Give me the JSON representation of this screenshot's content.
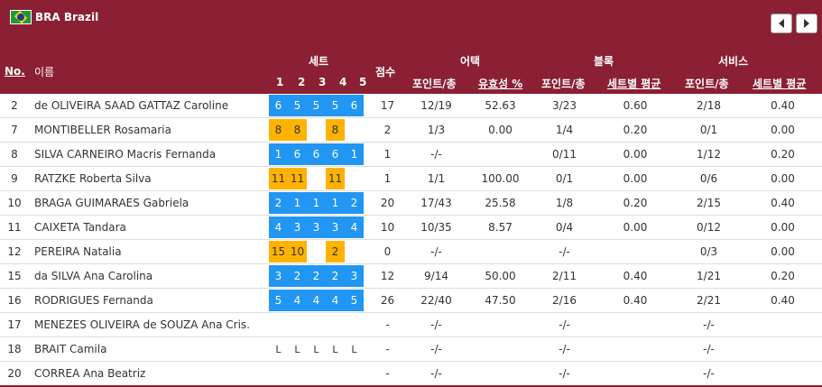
{
  "team": {
    "name": "BRA Brazil"
  },
  "headers": {
    "no": "No.",
    "name": "이름",
    "sets": "세트",
    "set_numbers": [
      "1",
      "2",
      "3",
      "4",
      "5"
    ],
    "points": "점수",
    "attack": "어택",
    "attack_pt": "포인트/총",
    "attack_eff": "유효성 %",
    "block": "블록",
    "block_pt": "포인트/총",
    "block_avg": "세트별 평균",
    "serve": "서비스",
    "serve_pt": "포인트/총",
    "serve_avg": "세트별 평균"
  },
  "colors": {
    "header_bg": "#8b1f33",
    "set_blue": "#2196f3",
    "set_yellow": "#ffb300"
  },
  "players": [
    {
      "no": "2",
      "name": "de OLIVEIRA SAAD GATTAZ Caroline",
      "sets": [
        [
          "6",
          "b"
        ],
        [
          "5",
          "b"
        ],
        [
          "5",
          "b"
        ],
        [
          "5",
          "b"
        ],
        [
          "6",
          "b"
        ]
      ],
      "points": "17",
      "att": "12/19",
      "eff": "52.63",
      "blk": "3/23",
      "blk_avg": "0.60",
      "srv": "2/18",
      "srv_avg": "0.40"
    },
    {
      "no": "7",
      "name": "MONTIBELLER Rosamaria",
      "sets": [
        [
          "8",
          "y"
        ],
        [
          "8",
          "y"
        ],
        [
          "",
          ""
        ],
        [
          "8",
          "y"
        ],
        [
          "",
          ""
        ]
      ],
      "points": "2",
      "att": "1/3",
      "eff": "0.00",
      "blk": "1/4",
      "blk_avg": "0.20",
      "srv": "0/1",
      "srv_avg": "0.00"
    },
    {
      "no": "8",
      "name": "SILVA CARNEIRO Macris Fernanda",
      "sets": [
        [
          "1",
          "b"
        ],
        [
          "6",
          "b"
        ],
        [
          "6",
          "b"
        ],
        [
          "6",
          "b"
        ],
        [
          "1",
          "b"
        ]
      ],
      "points": "1",
      "att": "-/-",
      "eff": "",
      "blk": "0/11",
      "blk_avg": "0.00",
      "srv": "1/12",
      "srv_avg": "0.20"
    },
    {
      "no": "9",
      "name": "RATZKE Roberta Silva",
      "sets": [
        [
          "11",
          "y"
        ],
        [
          "11",
          "y"
        ],
        [
          "",
          ""
        ],
        [
          "11",
          "y"
        ],
        [
          "",
          ""
        ]
      ],
      "points": "1",
      "att": "1/1",
      "eff": "100.00",
      "blk": "0/1",
      "blk_avg": "0.00",
      "srv": "0/6",
      "srv_avg": "0.00"
    },
    {
      "no": "10",
      "name": "BRAGA GUIMARAES Gabriela",
      "sets": [
        [
          "2",
          "b"
        ],
        [
          "1",
          "b"
        ],
        [
          "1",
          "b"
        ],
        [
          "1",
          "b"
        ],
        [
          "2",
          "b"
        ]
      ],
      "points": "20",
      "att": "17/43",
      "eff": "25.58",
      "blk": "1/8",
      "blk_avg": "0.20",
      "srv": "2/15",
      "srv_avg": "0.40"
    },
    {
      "no": "11",
      "name": "CAIXETA Tandara",
      "sets": [
        [
          "4",
          "b"
        ],
        [
          "3",
          "b"
        ],
        [
          "3",
          "b"
        ],
        [
          "3",
          "b"
        ],
        [
          "4",
          "b"
        ]
      ],
      "points": "10",
      "att": "10/35",
      "eff": "8.57",
      "blk": "0/4",
      "blk_avg": "0.00",
      "srv": "0/12",
      "srv_avg": "0.00"
    },
    {
      "no": "12",
      "name": "PEREIRA Natalia",
      "sets": [
        [
          "15",
          "y"
        ],
        [
          "10",
          "y"
        ],
        [
          "",
          ""
        ],
        [
          "2",
          "y"
        ],
        [
          "",
          ""
        ]
      ],
      "points": "0",
      "att": "-/-",
      "eff": "",
      "blk": "-/-",
      "blk_avg": "",
      "srv": "0/3",
      "srv_avg": "0.00"
    },
    {
      "no": "15",
      "name": "da SILVA Ana Carolina",
      "sets": [
        [
          "3",
          "b"
        ],
        [
          "2",
          "b"
        ],
        [
          "2",
          "b"
        ],
        [
          "2",
          "b"
        ],
        [
          "3",
          "b"
        ]
      ],
      "points": "12",
      "att": "9/14",
      "eff": "50.00",
      "blk": "2/11",
      "blk_avg": "0.40",
      "srv": "1/21",
      "srv_avg": "0.20"
    },
    {
      "no": "16",
      "name": "RODRIGUES Fernanda",
      "sets": [
        [
          "5",
          "b"
        ],
        [
          "4",
          "b"
        ],
        [
          "4",
          "b"
        ],
        [
          "4",
          "b"
        ],
        [
          "5",
          "b"
        ]
      ],
      "points": "26",
      "att": "22/40",
      "eff": "47.50",
      "blk": "2/16",
      "blk_avg": "0.40",
      "srv": "2/21",
      "srv_avg": "0.40"
    },
    {
      "no": "17",
      "name": "MENEZES OLIVEIRA de SOUZA Ana Cris.",
      "sets": [
        [
          "",
          ""
        ],
        [
          "",
          ""
        ],
        [
          "",
          ""
        ],
        [
          "",
          ""
        ],
        [
          "",
          ""
        ]
      ],
      "points": "-",
      "att": "-/-",
      "eff": "",
      "blk": "-/-",
      "blk_avg": "",
      "srv": "-/-",
      "srv_avg": ""
    },
    {
      "no": "18",
      "name": "BRAIT Camila",
      "sets": [
        [
          "L",
          "l"
        ],
        [
          "L",
          "l"
        ],
        [
          "L",
          "l"
        ],
        [
          "L",
          "l"
        ],
        [
          "L",
          "l"
        ]
      ],
      "points": "-",
      "att": "-/-",
      "eff": "",
      "blk": "-/-",
      "blk_avg": "",
      "srv": "-/-",
      "srv_avg": ""
    },
    {
      "no": "20",
      "name": "CORREA Ana Beatriz",
      "sets": [
        [
          "",
          ""
        ],
        [
          "",
          ""
        ],
        [
          "",
          ""
        ],
        [
          "",
          ""
        ],
        [
          "",
          ""
        ]
      ],
      "points": "-",
      "att": "-/-",
      "eff": "",
      "blk": "-/-",
      "blk_avg": "",
      "srv": "-/-",
      "srv_avg": ""
    }
  ]
}
